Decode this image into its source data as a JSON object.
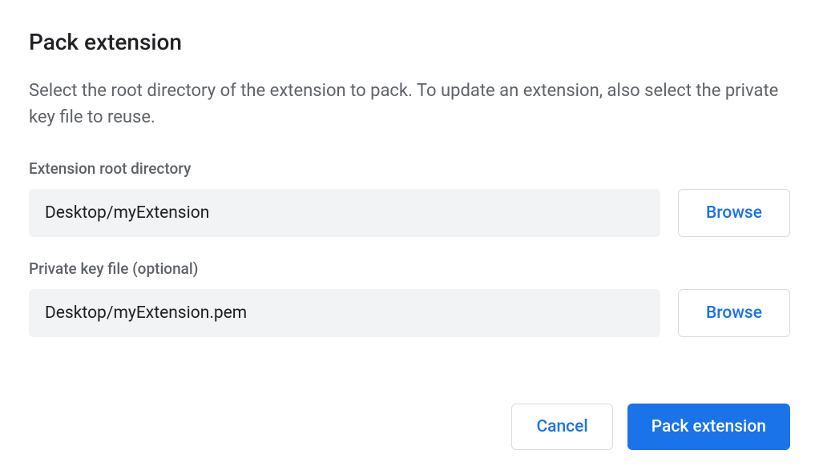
{
  "dialog": {
    "title": "Pack extension",
    "description": "Select the root directory of the extension to pack. To update an extension, also select the private key file to reuse."
  },
  "fields": {
    "root_directory": {
      "label": "Extension root directory",
      "value": "Desktop/myExtension",
      "browse_label": "Browse"
    },
    "private_key": {
      "label": "Private key file (optional)",
      "value": "Desktop/myExtension.pem",
      "browse_label": "Browse"
    }
  },
  "actions": {
    "cancel_label": "Cancel",
    "confirm_label": "Pack extension"
  }
}
